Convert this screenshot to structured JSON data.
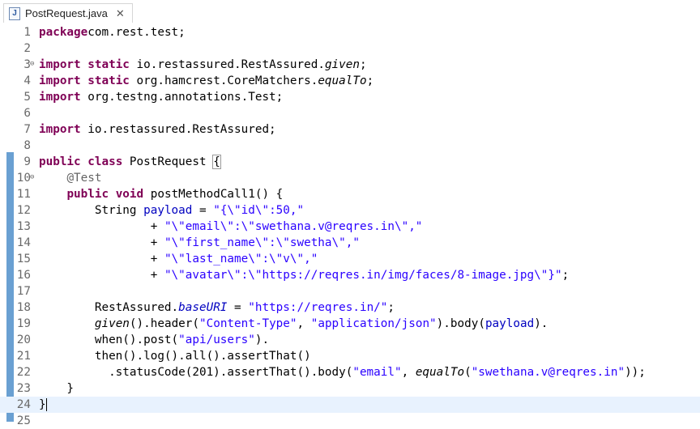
{
  "tab": {
    "title": "PostRequest.java",
    "icon": "java-file-icon"
  },
  "colors": {
    "keyword": "#7f0055",
    "string": "#2a00ff",
    "annotation": "#646464",
    "field": "#0000c0",
    "current_line": "#e8f2fe",
    "gutter_marker": "#6aa0d2"
  },
  "lines": [
    {
      "n": "1",
      "t": [
        [
          "kw",
          "package"
        ],
        [
          "",
          "com.rest.test;"
        ]
      ]
    },
    {
      "n": "2",
      "t": []
    },
    {
      "n": "3",
      "fold": true,
      "t": [
        [
          "kw",
          "import"
        ],
        [
          "",
          " "
        ],
        [
          "kw",
          "static"
        ],
        [
          "",
          " io.restassured.RestAssured."
        ],
        [
          "it",
          "given"
        ],
        [
          "",
          ";"
        ]
      ]
    },
    {
      "n": "4",
      "t": [
        [
          "kw",
          "import"
        ],
        [
          "",
          " "
        ],
        [
          "kw",
          "static"
        ],
        [
          "",
          " org.hamcrest.CoreMatchers."
        ],
        [
          "it",
          "equalTo"
        ],
        [
          "",
          ";"
        ]
      ]
    },
    {
      "n": "5",
      "t": [
        [
          "kw",
          "import"
        ],
        [
          "",
          " org.testng.annotations.Test;"
        ]
      ]
    },
    {
      "n": "6",
      "t": []
    },
    {
      "n": "7",
      "t": [
        [
          "kw",
          "import"
        ],
        [
          "",
          " io.restassured.RestAssured;"
        ]
      ]
    },
    {
      "n": "8",
      "t": []
    },
    {
      "n": "9",
      "t": [
        [
          "kw",
          "public"
        ],
        [
          "",
          " "
        ],
        [
          "kw",
          "class"
        ],
        [
          "",
          " PostRequest "
        ],
        [
          "bracket",
          "{"
        ]
      ]
    },
    {
      "n": "10",
      "fold": true,
      "t": [
        [
          "",
          "    "
        ],
        [
          "ann",
          "@Test"
        ]
      ]
    },
    {
      "n": "11",
      "t": [
        [
          "",
          "    "
        ],
        [
          "kw",
          "public"
        ],
        [
          "",
          " "
        ],
        [
          "kw",
          "void"
        ],
        [
          "",
          " postMethodCall1() {"
        ]
      ]
    },
    {
      "n": "12",
      "t": [
        [
          "",
          "        String "
        ],
        [
          "field",
          "payload"
        ],
        [
          "",
          " = "
        ],
        [
          "str",
          "\"{\\\"id\\\":50,\""
        ]
      ]
    },
    {
      "n": "13",
      "t": [
        [
          "",
          "                + "
        ],
        [
          "str",
          "\"\\\"email\\\":\\\"swethana.v@reqres.in\\\",\""
        ]
      ]
    },
    {
      "n": "14",
      "t": [
        [
          "",
          "                + "
        ],
        [
          "str",
          "\"\\\"first_name\\\":\\\"swetha\\\",\""
        ]
      ]
    },
    {
      "n": "15",
      "t": [
        [
          "",
          "                + "
        ],
        [
          "str",
          "\"\\\"last_name\\\":\\\"v\\\",\""
        ]
      ]
    },
    {
      "n": "16",
      "t": [
        [
          "",
          "                + "
        ],
        [
          "str",
          "\"\\\"avatar\\\":\\\"https://reqres.in/img/faces/8-image.jpg\\\"}\""
        ],
        [
          "",
          ";"
        ]
      ]
    },
    {
      "n": "17",
      "t": []
    },
    {
      "n": "18",
      "t": [
        [
          "",
          "        RestAssured."
        ],
        [
          "fi",
          "baseURI"
        ],
        [
          "",
          " = "
        ],
        [
          "str",
          "\"https://reqres.in/\""
        ],
        [
          "",
          ";"
        ]
      ]
    },
    {
      "n": "19",
      "t": [
        [
          "",
          "        "
        ],
        [
          "it",
          "given"
        ],
        [
          "",
          "().header("
        ],
        [
          "str",
          "\"Content-Type\""
        ],
        [
          "",
          ", "
        ],
        [
          "str",
          "\"application/json\""
        ],
        [
          "",
          ").body("
        ],
        [
          "field",
          "payload"
        ],
        [
          "",
          ")."
        ]
      ]
    },
    {
      "n": "20",
      "t": [
        [
          "",
          "        when().post("
        ],
        [
          "str",
          "\"api/users\""
        ],
        [
          "",
          ")."
        ]
      ]
    },
    {
      "n": "21",
      "t": [
        [
          "",
          "        then().log().all().assertThat()"
        ]
      ]
    },
    {
      "n": "22",
      "t": [
        [
          "",
          "          .statusCode(201).assertThat().body("
        ],
        [
          "str",
          "\"email\""
        ],
        [
          "",
          ", "
        ],
        [
          "it",
          "equalTo"
        ],
        [
          "",
          "("
        ],
        [
          "str",
          "\"swethana.v@reqres.in\""
        ],
        [
          "",
          "));"
        ]
      ]
    },
    {
      "n": "23",
      "t": [
        [
          "",
          "    }"
        ]
      ]
    },
    {
      "n": "24",
      "current": true,
      "caret": true,
      "t": [
        [
          "",
          "}"
        ]
      ]
    },
    {
      "n": "25",
      "t": []
    }
  ]
}
